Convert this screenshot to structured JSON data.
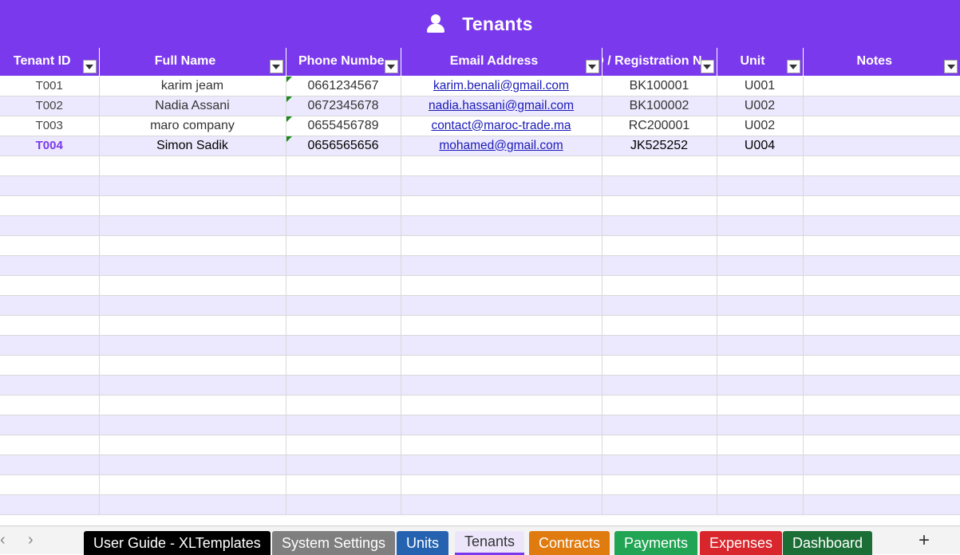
{
  "banner": {
    "title": "Tenants"
  },
  "columns": [
    {
      "label": "Tenant ID"
    },
    {
      "label": "Full Name"
    },
    {
      "label": "Phone Numbe"
    },
    {
      "label": "Email Address"
    },
    {
      "label": "D / Registration N"
    },
    {
      "label": "Unit"
    },
    {
      "label": "Notes"
    }
  ],
  "rows": [
    {
      "id": "T001",
      "name": "karim jeam",
      "phone": "0661234567",
      "email": "karim.benali@gmail.com",
      "reg": "BK100001",
      "unit": "U001",
      "notes": ""
    },
    {
      "id": "T002",
      "name": "Nadia Assani",
      "phone": "0672345678",
      "email": "nadia.hassani@gmail.com",
      "reg": "BK100002",
      "unit": "U002",
      "notes": ""
    },
    {
      "id": "T003",
      "name": "maro company",
      "phone": "0655456789",
      "email": "contact@maroc-trade.ma",
      "reg": "RC200001",
      "unit": "U002",
      "notes": ""
    },
    {
      "id": "T004",
      "name": "Simon Sadik",
      "phone": "0656565656",
      "email": "mohamed@gmail.com",
      "reg": "JK525252",
      "unit": "U004",
      "notes": ""
    }
  ],
  "tabs": [
    {
      "label": "User Guide - XLTemplates",
      "color": "#000000"
    },
    {
      "label": "System Settings",
      "color": "#7f7f7f"
    },
    {
      "label": "Units",
      "color": "#2563b0"
    },
    {
      "label": "Tenants",
      "color": "#ede6fb"
    },
    {
      "label": "Contracts",
      "color": "#e07b10"
    },
    {
      "label": "Payments",
      "color": "#21a453"
    },
    {
      "label": "Expenses",
      "color": "#d9262c"
    },
    {
      "label": "Dashboard",
      "color": "#1b6e35"
    }
  ],
  "tabbar": {
    "prev_icon": "chevron-left-icon",
    "next_icon": "chevron-right-icon",
    "add_label": "+"
  },
  "colors": {
    "accent": "#7b39ed",
    "alt_row": "#ece8fd",
    "link": "#1a1ab8"
  }
}
